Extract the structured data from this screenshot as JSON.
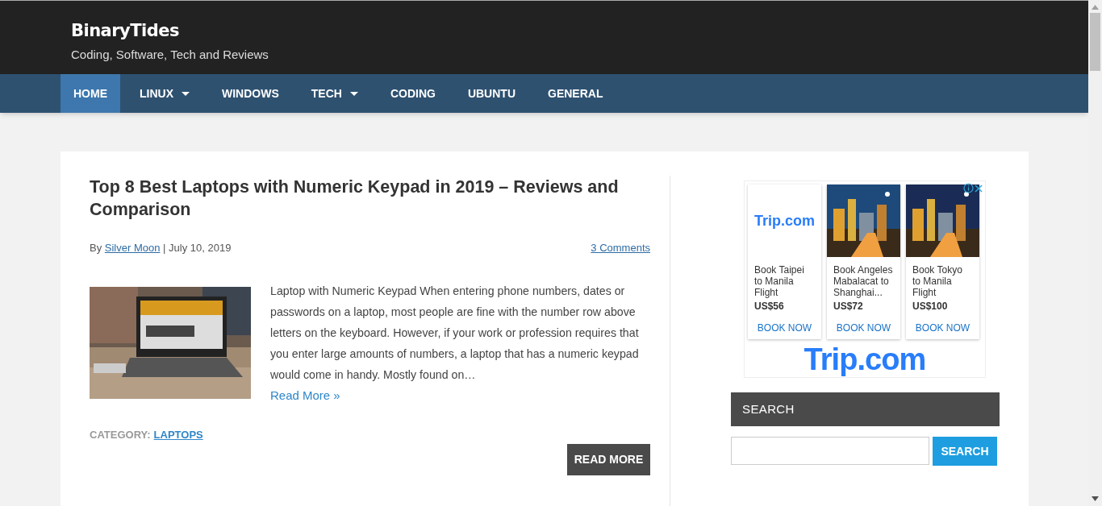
{
  "site": {
    "title": "BinaryTides",
    "tagline": "Coding, Software, Tech and Reviews"
  },
  "nav": [
    {
      "label": "HOME",
      "selected": true,
      "dropdown": false
    },
    {
      "label": "LINUX",
      "selected": false,
      "dropdown": true
    },
    {
      "label": "WINDOWS",
      "selected": false,
      "dropdown": false
    },
    {
      "label": "TECH",
      "selected": false,
      "dropdown": true
    },
    {
      "label": "CODING",
      "selected": false,
      "dropdown": false
    },
    {
      "label": "UBUNTU",
      "selected": false,
      "dropdown": false
    },
    {
      "label": "GENERAL",
      "selected": false,
      "dropdown": false
    }
  ],
  "post": {
    "title": "Top 8 Best Laptops with Numeric Keypad in 2019 – Reviews and Comparison",
    "by": "By",
    "author": "Silver Moon",
    "separator": "|",
    "date": "July 10, 2019",
    "comments": "3 Comments",
    "excerpt": "Laptop with Numeric Keypad When entering phone numbers, dates or passwords on a laptop, most people are fine with the number row above letters on the keyboard. However, if your work or profession requires that you enter large amounts of numbers, a laptop that has a numeric keypad would come in handy. Mostly found on…",
    "read_more_link": "Read More »",
    "category_label": "CATEGORY:",
    "category": "LAPTOPS",
    "read_more_button": "READ MORE"
  },
  "ad": {
    "cards": [
      {
        "kind": "logo",
        "logo": "Trip.com",
        "title": "Book Taipei to Manila Flight",
        "price": "US$56",
        "button": "BOOK NOW"
      },
      {
        "kind": "picture",
        "title": "Book Angeles Mabalacat to Shanghai...",
        "price": "US$72",
        "button": "BOOK NOW"
      },
      {
        "kind": "picture",
        "title": "Book Tokyo to Manila Flight",
        "price": "US$100",
        "button": "BOOK NOW"
      }
    ],
    "logo": "Trip.com"
  },
  "search": {
    "heading": "SEARCH",
    "button": "SEARCH"
  }
}
